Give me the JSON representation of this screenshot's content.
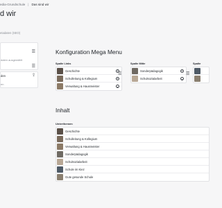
{
  "breadcrumb": [
    "edia-Grundschule",
    "Das sind wir"
  ],
  "page_title": "d wir",
  "seo_label": "etadaten (SEO)",
  "left_panel": {
    "card1_line": "daten ausgewählt",
    "card2_label": "den",
    "card2_text": "en"
  },
  "mega_menu": {
    "title": "Konfiguration Mega Menu",
    "columns": [
      {
        "label": "Spalte Links",
        "items": [
          "Geschichte",
          "Schulleitung & Kollegium",
          "Verwaltung & Hausmeister"
        ]
      },
      {
        "label": "Spalte Mitte",
        "items": [
          "Sonderpädagogik",
          "Schulsozialarbeit"
        ]
      },
      {
        "label": "Spalte",
        "items": [
          "",
          ""
        ]
      }
    ]
  },
  "inhalt": {
    "title": "Inhalt",
    "unterthemen_label": "Unterthemen",
    "items": [
      "Geschichte",
      "Schulleitung & Kollegium",
      "Verwaltung & Hausmeister",
      "Sonderpädagogik",
      "Schulsozialarbeit",
      "Schule im Kiez",
      "Gute gesunde Schule"
    ]
  },
  "thumb_colors": [
    "#5a5048",
    "#7a6b5c",
    "#8c7a66",
    "#6f6a63",
    "#b8a896",
    "#4e5a66",
    "#8a7f70"
  ]
}
